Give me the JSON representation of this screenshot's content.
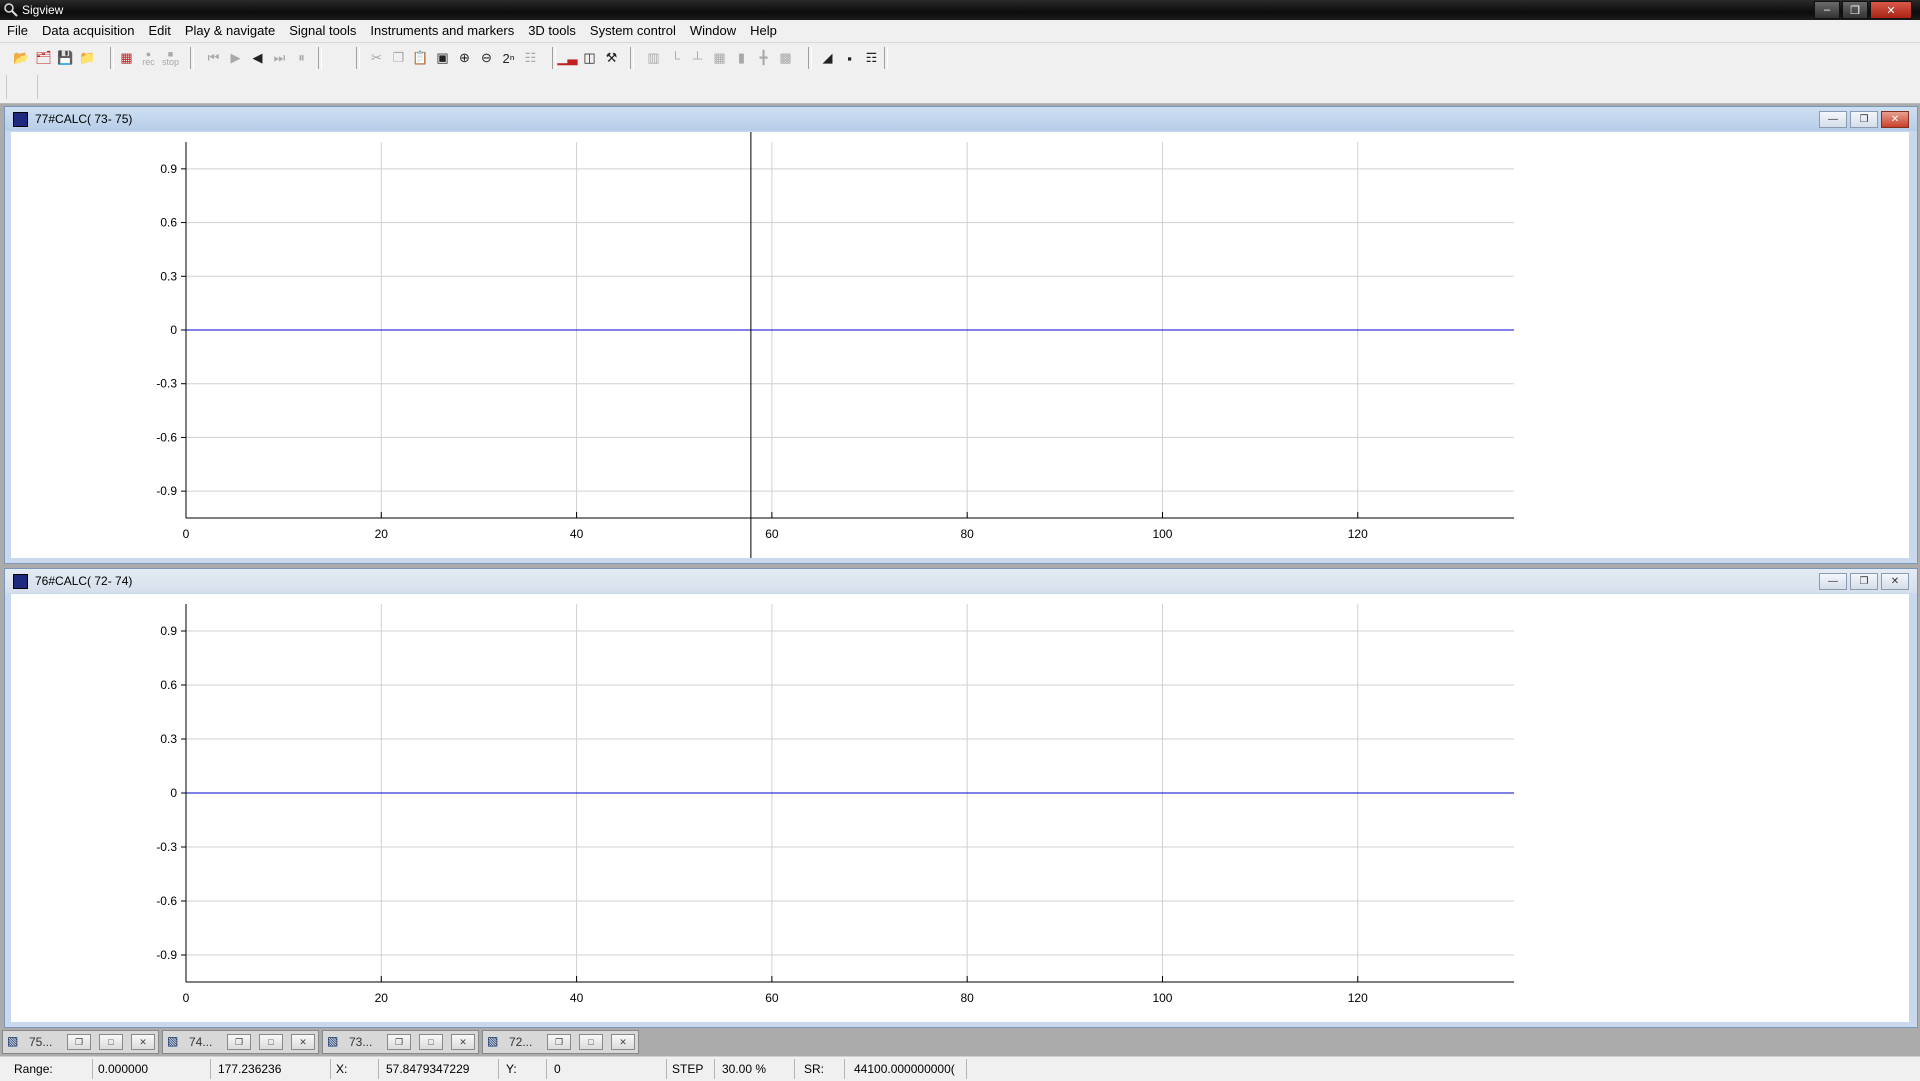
{
  "app": {
    "title": "Sigview"
  },
  "menu": [
    "File",
    "Data acquisition",
    "Edit",
    "Play & navigate",
    "Signal tools",
    "Instruments and markers",
    "3D tools",
    "System control",
    "Window",
    "Help"
  ],
  "toolbar": {
    "file_icons": [
      "open-folder-icon",
      "open-multiple-icon",
      "save-icon",
      "open-recent-icon"
    ],
    "record_icons": [
      "acquire-icon",
      "rec-icon",
      "stop-icon"
    ],
    "rec_label": "rec",
    "stop_label": "stop",
    "nav_icons": [
      "skip-start-icon",
      "play-icon",
      "speaker-icon",
      "skip-end-icon",
      "pause-icon"
    ],
    "edit_icons": [
      "cut-icon",
      "copy-icon",
      "paste-icon",
      "zoom-window-icon",
      "zoom-in-icon",
      "zoom-out-icon",
      "power-of-two-icon",
      "properties-icon"
    ],
    "power_label": "2ⁿ",
    "tool_icons": [
      "fft-icon",
      "calculator-icon",
      "tools-icon"
    ],
    "layout_icons": [
      "bars-icon",
      "marker-icon",
      "step-marker-icon",
      "grid-icon",
      "export-icon",
      "cursor-cross-icon",
      "zoom-box-icon"
    ],
    "window_icons": [
      "tile-icon",
      "cascade-icon",
      "tree-icon"
    ]
  },
  "windows": [
    {
      "title": "77#CALC( 73- 75)",
      "active": true,
      "chart_data": {
        "type": "line",
        "series": [
          {
            "x": [
              0,
              136
            ],
            "y": [
              0,
              0
            ]
          }
        ],
        "xlim": [
          0,
          136
        ],
        "ylim": [
          -1.05,
          1.05
        ],
        "xticks": [
          "0",
          "20",
          "40",
          "60",
          "80",
          "100",
          "120"
        ],
        "yticks": [
          "0.9",
          "0.6",
          "0.3",
          "0",
          "-0.3",
          "-0.6",
          "-0.9"
        ],
        "cursor_x": 57.85,
        "grid": true
      }
    },
    {
      "title": "76#CALC( 72- 74)",
      "active": false,
      "chart_data": {
        "type": "line",
        "series": [
          {
            "x": [
              0,
              136
            ],
            "y": [
              0,
              0
            ]
          }
        ],
        "xlim": [
          0,
          136
        ],
        "ylim": [
          -1.05,
          1.05
        ],
        "xticks": [
          "0",
          "20",
          "40",
          "60",
          "80",
          "100",
          "120"
        ],
        "yticks": [
          "0.9",
          "0.6",
          "0.3",
          "0",
          "-0.3",
          "-0.6",
          "-0.9"
        ],
        "grid": true
      }
    }
  ],
  "taskbar": [
    {
      "label": "75..."
    },
    {
      "label": "74..."
    },
    {
      "label": "73..."
    },
    {
      "label": "72..."
    }
  ],
  "status": {
    "range_label": "Range:",
    "range_start": "0.000000",
    "range_end": "177.236236",
    "x_label": "X:",
    "x_value": "57.8479347229",
    "y_label": "Y:",
    "y_value": "0",
    "step_label": "STEP",
    "step_value": "30.00 %",
    "sr_label": "SR:",
    "sr_value": "44100.000000000("
  },
  "colors": {
    "signal": "#0000cc",
    "grid": "#d0d0d0",
    "cursor": "#000000"
  }
}
